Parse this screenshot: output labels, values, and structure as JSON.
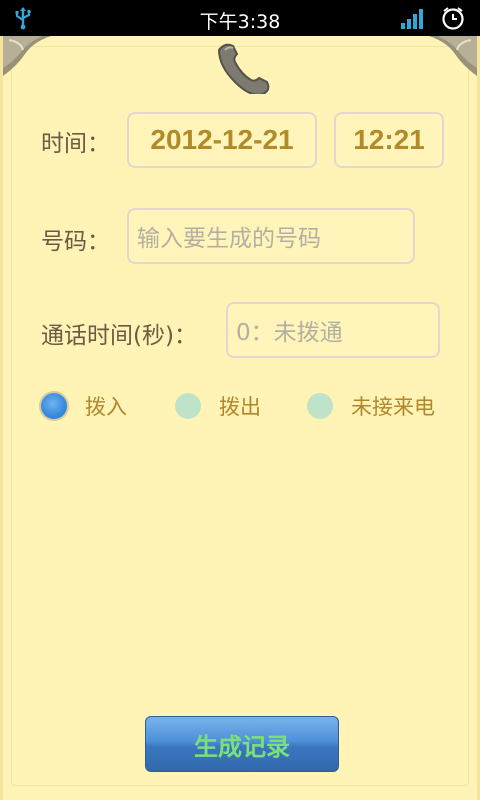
{
  "statusbar": {
    "time": "下午3:38",
    "icons": [
      "usb-icon",
      "signal-icon",
      "clock-icon"
    ]
  },
  "form": {
    "time_label": "时间：",
    "date_value": "2012-12-21",
    "time_value": "12:21",
    "number_label": "号码：",
    "number_placeholder": "输入要生成的号码",
    "duration_label": "通话时间(秒)：",
    "duration_placeholder": "0：未拨通",
    "call_types": [
      {
        "label": "拨入",
        "checked": true
      },
      {
        "label": "拨出",
        "checked": false
      },
      {
        "label": "未接来电",
        "checked": false
      }
    ]
  },
  "actions": {
    "generate_label": "生成记录"
  },
  "colors": {
    "paper": "#fff4b6",
    "value_text": "#b18a2a",
    "label_text": "#6b5a44",
    "radio_label": "#b1862c",
    "button_text": "#7ce07a",
    "button_bg": "#4d8fd8"
  }
}
